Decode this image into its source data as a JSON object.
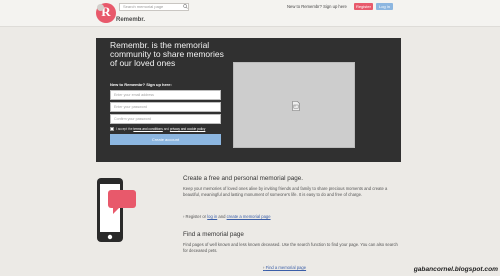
{
  "header": {
    "brand": "Remembr.",
    "search_placeholder": "Search memorial page",
    "new_link": "New to Remembr? Sign up here",
    "register_label": "Register",
    "login_label": "Log in",
    "accent": "#e8596b",
    "secondary": "#8cb6e0"
  },
  "hero": {
    "title": "Remembr. is the memorial community to share memories of our loved ones",
    "signup_heading": "New to Remembr? Sign up here:",
    "email_placeholder": "Enter your email address",
    "password_placeholder": "Enter your password",
    "confirm_placeholder": "Confirm your password",
    "terms_prefix": "I accept the",
    "terms_link": "terms and conditions",
    "terms_and": "and",
    "privacy_link": "privacy and cookie policy",
    "create_button": "Create account",
    "photo_icon": "image-placeholder-icon"
  },
  "section1": {
    "title": "Create a free and personal memorial page.",
    "text": "Keep your memories of loved ones alive by inviting friends and family to share precious moments and create a beautiful, meaningful and lasting monument of someone's life. It is easy to do and free of charge.",
    "prefix": "› Register or",
    "login_link": "log in",
    "and_text": "and",
    "create_link": "create a memorial page",
    "icon": "phone-chat-icon"
  },
  "section2": {
    "title": "Find a memorial page",
    "text": "Find pages of well known and less known deceased. Use the search function to find your page. You can also search for deceased pets.",
    "chevron": "›",
    "link": "Find a memorial page"
  },
  "watermark": "gabancornel.blogspot.com"
}
